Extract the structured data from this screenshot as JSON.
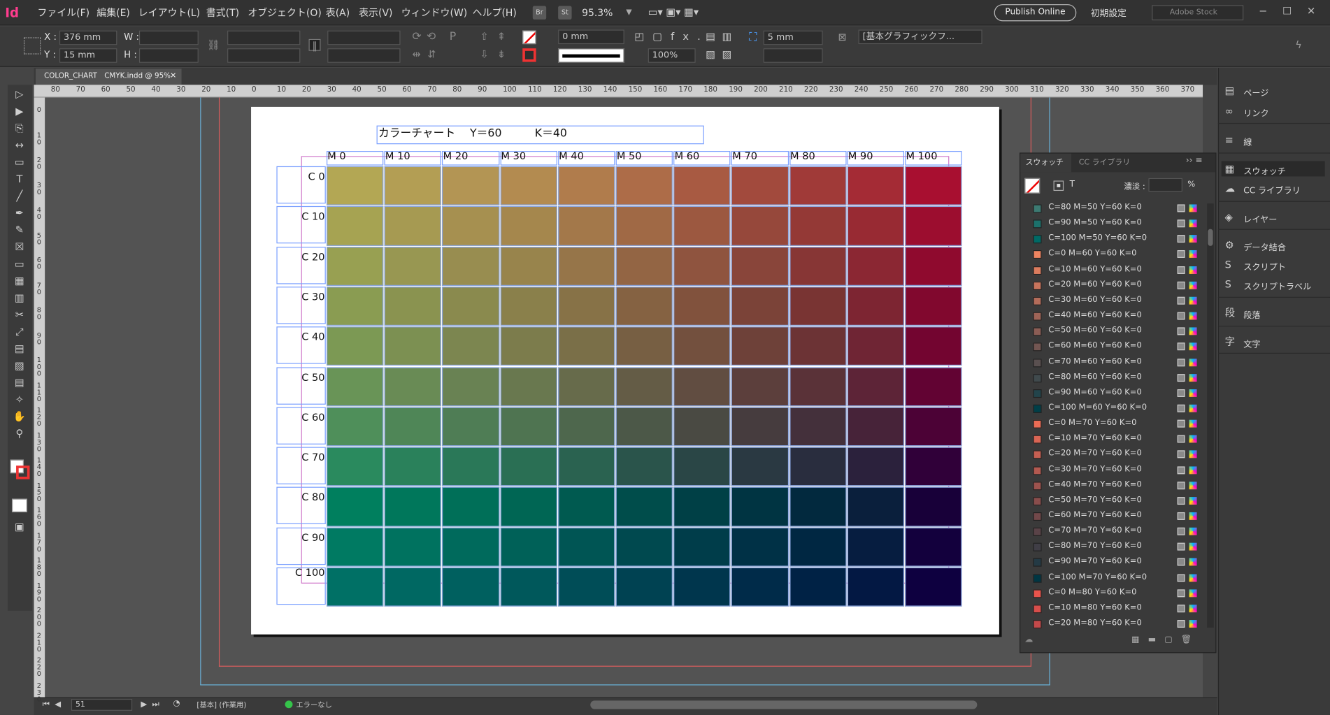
{
  "app": {
    "logo": "Id"
  },
  "menu": [
    "ファイル(F)",
    "編集(E)",
    "レイアウト(L)",
    "書式(T)",
    "オブジェクト(O)",
    "表(A)",
    "表示(V)",
    "ウィンドウ(W)",
    "ヘルプ(H)"
  ],
  "menu_badges": [
    "Br",
    "St"
  ],
  "zoom": "95.3%",
  "publish_label": "Publish Online",
  "workspace": "初期設定",
  "stock_placeholder": "Adobe Stock",
  "control": {
    "x_label": "X :",
    "x_value": "376 mm",
    "y_label": "Y :",
    "y_value": "15 mm",
    "w_label": "W :",
    "h_label": "H :",
    "stroke_weight": "0 mm",
    "opacity": "100%",
    "offset": "5 mm",
    "object_style": "[基本グラフィックフ..."
  },
  "doc_tab": {
    "title": "COLOR_CHART　CMYK.indd @ 95%"
  },
  "ruler": {
    "h_ticks": [
      "80",
      "70",
      "60",
      "50",
      "40",
      "30",
      "20",
      "10",
      "0",
      "10",
      "20",
      "30",
      "40",
      "50",
      "60",
      "70",
      "80",
      "90",
      "100",
      "110",
      "120",
      "130",
      "140",
      "150",
      "160",
      "170",
      "180",
      "190",
      "200",
      "210",
      "220",
      "230",
      "240",
      "250",
      "260",
      "270",
      "280",
      "290",
      "300",
      "310",
      "320",
      "330",
      "340",
      "350",
      "360",
      "370"
    ],
    "v_ticks": [
      "0",
      "1\n0",
      "2\n0",
      "3\n0",
      "4\n0",
      "5\n0",
      "6\n0",
      "7\n0",
      "8\n0",
      "9\n0",
      "1\n0\n0",
      "1\n1\n0",
      "1\n2\n0",
      "1\n3\n0",
      "1\n4\n0",
      "1\n5\n0",
      "1\n6\n0",
      "1\n7\n0",
      "1\n8\n0",
      "1\n9\n0",
      "2\n0\n0",
      "2\n1\n0",
      "2\n2\n0",
      "2\n3\n0"
    ]
  },
  "chart": {
    "title": "カラーチャート　 Y＝60　　　K＝40",
    "col_labels": [
      "M 0",
      "M 10",
      "M 20",
      "M 30",
      "M 40",
      "M 50",
      "M 60",
      "M 70",
      "M 80",
      "M 90",
      "M 100"
    ],
    "row_labels": [
      "C 0",
      "C 10",
      "C 20",
      "C 30",
      "C 40",
      "C 50",
      "C 60",
      "C 70",
      "C 80",
      "C 90",
      "C 100"
    ],
    "color_rows": [
      [
        "#b3a754",
        "#b39e54",
        "#b39554",
        "#b38b50",
        "#b07c4c",
        "#ad6c48",
        "#a85a42",
        "#a24a3d",
        "#a03a38",
        "#a42b35",
        "#a80f30"
      ],
      [
        "#a6a352",
        "#a69a52",
        "#a69050",
        "#a5874d",
        "#a3784a",
        "#a06945",
        "#9c5840",
        "#96483b",
        "#943936",
        "#982a33",
        "#9c0d2f"
      ],
      [
        "#98a052",
        "#989752",
        "#988d50",
        "#98844c",
        "#967549",
        "#936544",
        "#8f543f",
        "#89453a",
        "#873635",
        "#8b2733",
        "#8f0a2e"
      ],
      [
        "#8a9c52",
        "#8a9350",
        "#8a8a4e",
        "#8a804b",
        "#877247",
        "#856242",
        "#81523d",
        "#7b4338",
        "#793433",
        "#7d2532",
        "#81082e"
      ],
      [
        "#7c9954",
        "#7c9052",
        "#7c8650",
        "#7c7c4c",
        "#7a6f48",
        "#775f43",
        "#73503e",
        "#6e4139",
        "#6c3335",
        "#6f2534",
        "#730530"
      ],
      [
        "#699457",
        "#698b55",
        "#698253",
        "#69784f",
        "#676b4b",
        "#645c46",
        "#614d41",
        "#5c3f3c",
        "#5a3238",
        "#5d2437",
        "#620333"
      ],
      [
        "#4f8f5a",
        "#4f8657",
        "#4f7d55",
        "#4f7451",
        "#4e674d",
        "#4c5848",
        "#4a4a43",
        "#463c3e",
        "#44303b",
        "#472339",
        "#4c0236"
      ],
      [
        "#2a8a5e",
        "#2a815b",
        "#2a7858",
        "#2a6f54",
        "#2a6250",
        "#2a544b",
        "#2a4646",
        "#2a3942",
        "#292d3e",
        "#2b213c",
        "#300039"
      ],
      [
        "#007f5e",
        "#00775b",
        "#006f58",
        "#006654",
        "#005a50",
        "#004d4b",
        "#004046",
        "#003442",
        "#02293e",
        "#0a1f3c",
        "#180039"
      ],
      [
        "#007a62",
        "#00725f",
        "#006a5c",
        "#006158",
        "#005554",
        "#00494f",
        "#003d4a",
        "#003146",
        "#002742",
        "#061d40",
        "#13003d"
      ],
      [
        "#007065",
        "#006862",
        "#00605f",
        "#00585b",
        "#004d57",
        "#004252",
        "#00364d",
        "#002b49",
        "#002245",
        "#031843",
        "#0e0040"
      ]
    ]
  },
  "swatch_panel": {
    "tabs": [
      "スウォッチ",
      "CC ライブラリ"
    ],
    "tint_label": "濃淡 :",
    "tint_unit": "%",
    "fill_type": "T",
    "swatches": [
      {
        "name": "C=80 M=50 Y=60 K=0",
        "color": "#3c7a72"
      },
      {
        "name": "C=90 M=50 Y=60 K=0",
        "color": "#1c716c"
      },
      {
        "name": "C=100 M=50 Y=60 K=0",
        "color": "#006a66"
      },
      {
        "name": "C=0 M=60 Y=60 K=0",
        "color": "#ee8460"
      },
      {
        "name": "C=10 M=60 Y=60 K=0",
        "color": "#dc7c5e"
      },
      {
        "name": "C=20 M=60 Y=60 K=0",
        "color": "#c8745c"
      },
      {
        "name": "C=30 M=60 Y=60 K=0",
        "color": "#b46c5a"
      },
      {
        "name": "C=40 M=60 Y=60 K=0",
        "color": "#9f6457"
      },
      {
        "name": "C=50 M=60 Y=60 K=0",
        "color": "#8b5d55"
      },
      {
        "name": "C=60 M=60 Y=60 K=0",
        "color": "#735652"
      },
      {
        "name": "C=70 M=60 Y=60 K=0",
        "color": "#5a5050"
      },
      {
        "name": "C=80 M=60 Y=60 K=0",
        "color": "#404a4d"
      },
      {
        "name": "C=90 M=60 Y=60 K=0",
        "color": "#22444b"
      },
      {
        "name": "C=100 M=60 Y=60 K=0",
        "color": "#003f48"
      },
      {
        "name": "C=0 M=70 Y=60 K=0",
        "color": "#ec6c55"
      },
      {
        "name": "C=10 M=70 Y=60 K=0",
        "color": "#da6554"
      },
      {
        "name": "C=20 M=70 Y=60 K=0",
        "color": "#c75f52"
      },
      {
        "name": "C=30 M=70 Y=60 K=0",
        "color": "#b35950"
      },
      {
        "name": "C=40 M=70 Y=60 K=0",
        "color": "#9e534e"
      },
      {
        "name": "C=50 M=70 Y=60 K=0",
        "color": "#894d4c"
      },
      {
        "name": "C=60 M=70 Y=60 K=0",
        "color": "#72484a"
      },
      {
        "name": "C=70 M=70 Y=60 K=0",
        "color": "#5a4348"
      },
      {
        "name": "C=80 M=70 Y=60 K=0",
        "color": "#403e46"
      },
      {
        "name": "C=90 M=70 Y=60 K=0",
        "color": "#243a45"
      },
      {
        "name": "C=100 M=70 Y=60 K=0",
        "color": "#003643"
      },
      {
        "name": "C=0 M=80 Y=60 K=0",
        "color": "#ea544c"
      },
      {
        "name": "C=10 M=80 Y=60 K=0",
        "color": "#d84e4b"
      },
      {
        "name": "C=20 M=80 Y=60 K=0",
        "color": "#c5494a"
      }
    ]
  },
  "dock": [
    {
      "label": "ページ",
      "icon": "pages-icon",
      "glyph": "▤"
    },
    {
      "label": "リンク",
      "icon": "links-icon",
      "glyph": "∞"
    },
    {
      "label": "線",
      "icon": "stroke-icon",
      "glyph": "≡"
    },
    {
      "label": "スウォッチ",
      "icon": "swatches-icon",
      "glyph": "▦"
    },
    {
      "label": "CC ライブラリ",
      "icon": "cc-library-icon",
      "glyph": "☁"
    },
    {
      "label": "レイヤー",
      "icon": "layers-icon",
      "glyph": "◈"
    },
    {
      "label": "データ結合",
      "icon": "data-merge-icon",
      "glyph": "⚙"
    },
    {
      "label": "スクリプト",
      "icon": "scripts-icon",
      "glyph": "S"
    },
    {
      "label": "スクリプトラベル",
      "icon": "script-label-icon",
      "glyph": "S"
    },
    {
      "label": "段落",
      "icon": "paragraph-icon",
      "glyph": "段"
    },
    {
      "label": "文字",
      "icon": "character-icon",
      "glyph": "字"
    }
  ],
  "status": {
    "page": "51",
    "mode": "[基本] (作業用)",
    "preflight": "エラーなし"
  }
}
